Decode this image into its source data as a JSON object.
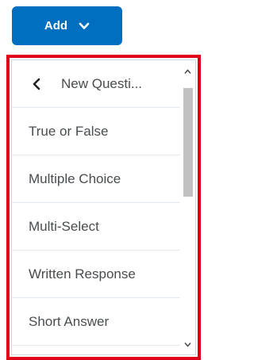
{
  "add_button": {
    "label": "Add",
    "icon": "chevron-down-icon"
  },
  "menu": {
    "header": {
      "back_icon": "chevron-left-icon",
      "label": "New Questi..."
    },
    "items": [
      {
        "label": "True or False"
      },
      {
        "label": "Multiple Choice"
      },
      {
        "label": "Multi-Select"
      },
      {
        "label": "Written Response"
      },
      {
        "label": "Short Answer"
      }
    ]
  },
  "colors": {
    "button_bg": "#006fbf",
    "highlight_border": "#e0001a",
    "text": "#494c4e"
  }
}
